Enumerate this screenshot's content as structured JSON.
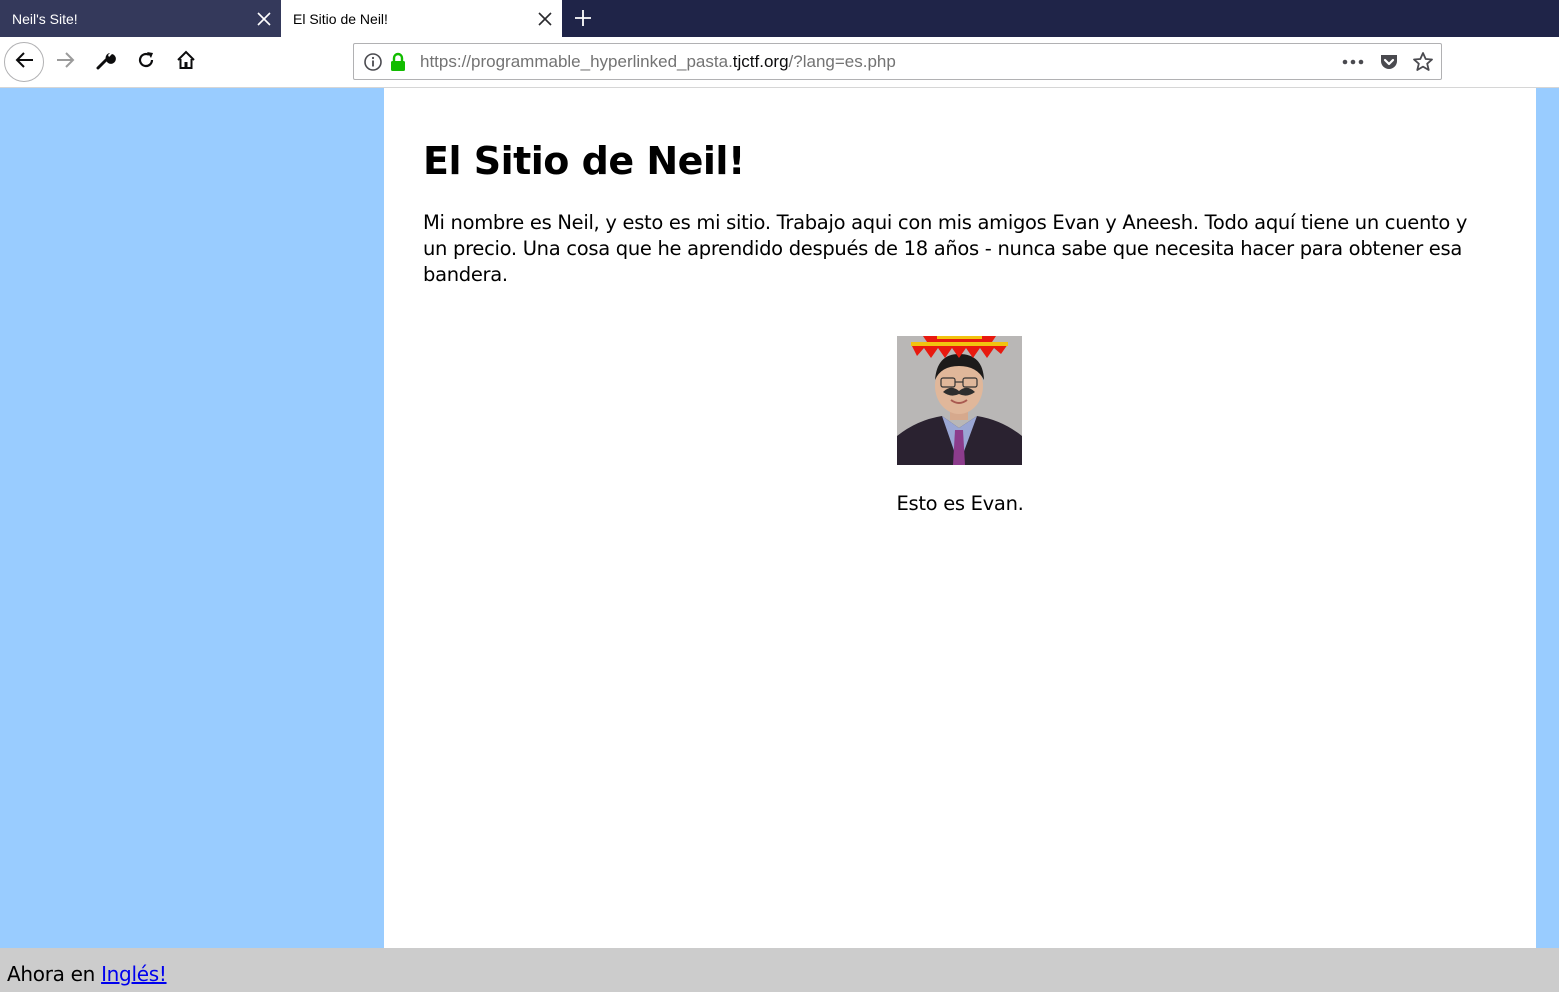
{
  "browser": {
    "tabs": [
      {
        "title": "Neil's Site!",
        "active": false
      },
      {
        "title": "El Sitio de Neil!",
        "active": true
      }
    ],
    "url": {
      "prefix": "https://programmable_hyperlinked_pasta.",
      "domain": "tjctf.org",
      "suffix": "/?lang=es.php"
    },
    "icons": {
      "back": "arrow-left-icon",
      "forward": "arrow-right-icon",
      "tools": "wrench-icon",
      "reload": "reload-icon",
      "home": "home-icon",
      "info": "info-icon",
      "lock": "lock-icon",
      "more": "more-dots-icon",
      "pocket": "pocket-icon",
      "bookmark": "star-icon",
      "close": "close-icon",
      "new_tab": "plus-icon"
    },
    "colors": {
      "tabstrip": "#1f2448",
      "lock": "#12bc00"
    }
  },
  "page": {
    "heading": "El Sitio de Neil!",
    "intro": "Mi nombre es Neil, y esto es mi sitio. Trabajo aqui con mis amigos Evan y Aneesh. Todo aquí tiene un cuento y un precio. Una cosa que he aprendido después de 18 años - nunca sabe que necesita hacer para obtener esa bandera.",
    "caption": "Esto es Evan.",
    "colors": {
      "side_background": "#99ccff",
      "content_background": "#ffffff",
      "footer_background": "#cccccc",
      "link": "#0000ee"
    }
  },
  "footer": {
    "prefix": "Ahora en",
    "link_text": "Inglés!"
  }
}
